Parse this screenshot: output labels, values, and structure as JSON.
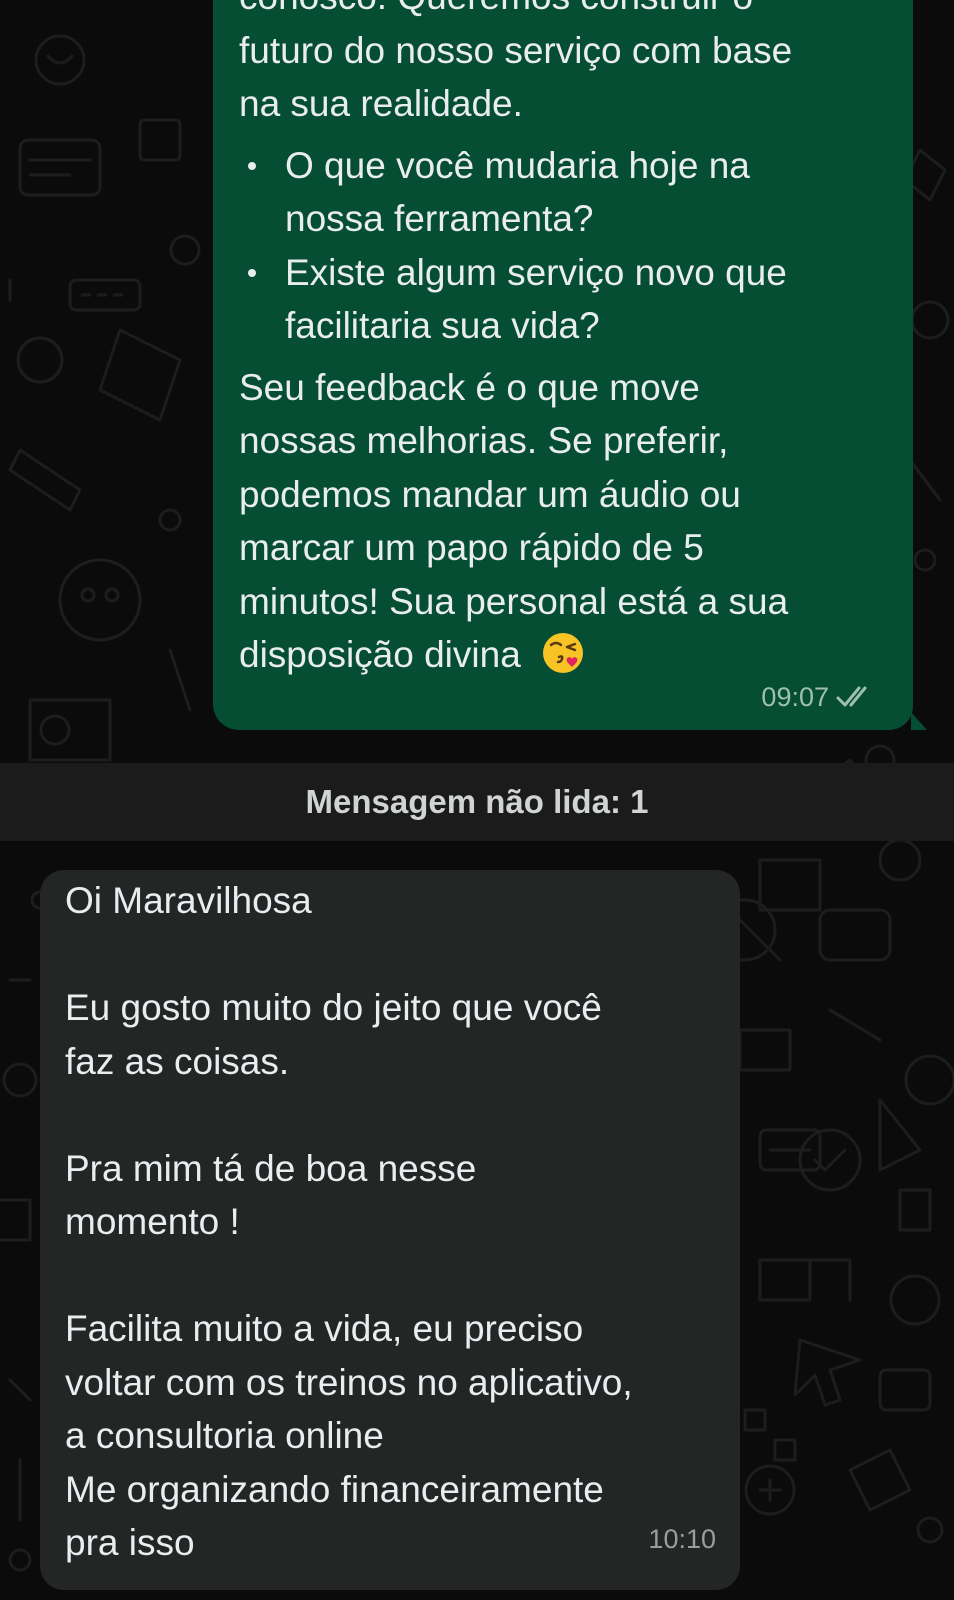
{
  "outgoing_message": {
    "paragraph1": [
      "conosco. Queremos construir o",
      "futuro do nosso serviço com base",
      "na sua realidade."
    ],
    "bullets": [
      [
        "O que você mudaria hoje na",
        "nossa ferramenta?"
      ],
      [
        "Existe algum serviço novo que",
        "facilitaria sua vida?"
      ]
    ],
    "paragraph2": [
      "Seu feedback é o que move",
      "nossas melhorias. Se preferir,",
      "podemos mandar um áudio ou",
      "marcar um papo rápido de 5",
      "minutos! Sua personal está a sua"
    ],
    "last_line": "disposição divina",
    "emoji": "kissing-face-with-heart-icon",
    "time": "09:07",
    "status_icon": "double-check-icon"
  },
  "unread_divider": {
    "label": "Mensagem não lida: 1"
  },
  "incoming_message": {
    "greeting": "Oi Maravilhosa",
    "paragraph1": [
      "Eu gosto muito do jeito que você",
      "faz as coisas."
    ],
    "paragraph2": [
      "Pra mim tá de boa nesse",
      "momento !"
    ],
    "paragraph3": [
      "Facilita muito a vida, eu preciso",
      "voltar com os treinos no aplicativo,",
      "a consultoria online",
      "Me organizando financeiramente",
      "pra isso"
    ],
    "time": "10:10"
  },
  "colors": {
    "background": "#0b0b0b",
    "outgoing_bubble": "#054d33",
    "incoming_bubble": "#242626",
    "divider_bar": "#1b1b1b",
    "text": "#e9edef"
  }
}
